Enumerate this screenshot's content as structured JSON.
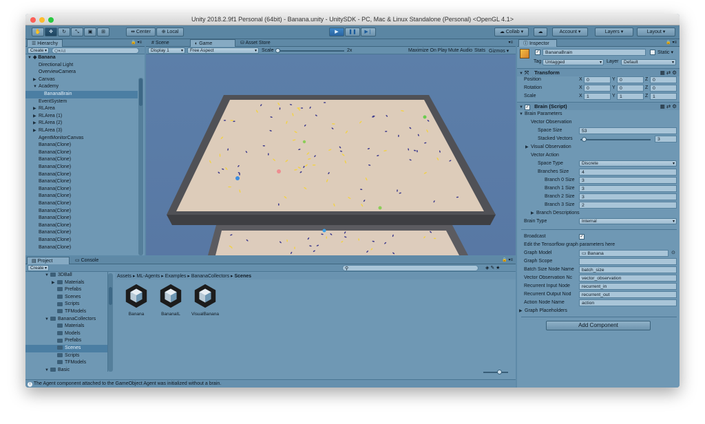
{
  "window": {
    "title": "Unity 2018.2.9f1 Personal (64bit) - Banana.unity - UnitySDK - PC, Mac & Linux Standalone (Personal) <OpenGL 4.1>"
  },
  "toolbar": {
    "pivot": "Center",
    "space": "Local",
    "collab": "Collab",
    "account": "Account",
    "layers": "Layers",
    "layout": "Layout"
  },
  "hierarchy": {
    "tab": "Hierarchy",
    "create": "Create",
    "search_placeholder": "Q▾All",
    "scene": "Banana",
    "items": [
      {
        "label": "Directional Light",
        "indent": 1,
        "arrow": ""
      },
      {
        "label": "OverviewCamera",
        "indent": 1,
        "arrow": ""
      },
      {
        "label": "Canvas",
        "indent": 1,
        "arrow": "▶"
      },
      {
        "label": "Academy",
        "indent": 1,
        "arrow": "▼"
      },
      {
        "label": "BananaBrain",
        "indent": 2,
        "arrow": "",
        "selected": true
      },
      {
        "label": "EventSystem",
        "indent": 1,
        "arrow": ""
      },
      {
        "label": "RLArea",
        "indent": 1,
        "arrow": "▶"
      },
      {
        "label": "RLArea (1)",
        "indent": 1,
        "arrow": "▶"
      },
      {
        "label": "RLArea (2)",
        "indent": 1,
        "arrow": "▶"
      },
      {
        "label": "RLArea (3)",
        "indent": 1,
        "arrow": "▶"
      },
      {
        "label": "AgentMonitorCanvas",
        "indent": 1,
        "arrow": ""
      },
      {
        "label": "Banana(Clone)",
        "indent": 1,
        "arrow": ""
      },
      {
        "label": "Banana(Clone)",
        "indent": 1,
        "arrow": ""
      },
      {
        "label": "Banana(Clone)",
        "indent": 1,
        "arrow": ""
      },
      {
        "label": "Banana(Clone)",
        "indent": 1,
        "arrow": ""
      },
      {
        "label": "Banana(Clone)",
        "indent": 1,
        "arrow": ""
      },
      {
        "label": "Banana(Clone)",
        "indent": 1,
        "arrow": ""
      },
      {
        "label": "Banana(Clone)",
        "indent": 1,
        "arrow": ""
      },
      {
        "label": "Banana(Clone)",
        "indent": 1,
        "arrow": ""
      },
      {
        "label": "Banana(Clone)",
        "indent": 1,
        "arrow": ""
      },
      {
        "label": "Banana(Clone)",
        "indent": 1,
        "arrow": ""
      },
      {
        "label": "Banana(Clone)",
        "indent": 1,
        "arrow": ""
      },
      {
        "label": "Banana(Clone)",
        "indent": 1,
        "arrow": ""
      },
      {
        "label": "Banana(Clone)",
        "indent": 1,
        "arrow": ""
      },
      {
        "label": "Banana(Clone)",
        "indent": 1,
        "arrow": ""
      },
      {
        "label": "Banana(Clone)",
        "indent": 1,
        "arrow": ""
      }
    ]
  },
  "game": {
    "tabs": [
      "Scene",
      "Game",
      "Asset Store"
    ],
    "display": "Display 1",
    "aspect": "Free Aspect",
    "scale_label": "Scale",
    "scale_value": "2x",
    "options": [
      "Maximize On Play",
      "Mute Audio",
      "Stats",
      "Gizmos"
    ]
  },
  "project": {
    "tabs": [
      "Project",
      "Console"
    ],
    "create": "Create",
    "tree": [
      {
        "label": "3DBall",
        "indent": 2,
        "arrow": "▼"
      },
      {
        "label": "Materials",
        "indent": 3,
        "arrow": "▶"
      },
      {
        "label": "Prefabs",
        "indent": 3,
        "arrow": ""
      },
      {
        "label": "Scenes",
        "indent": 3,
        "arrow": ""
      },
      {
        "label": "Scripts",
        "indent": 3,
        "arrow": ""
      },
      {
        "label": "TFModels",
        "indent": 3,
        "arrow": ""
      },
      {
        "label": "BananaCollectors",
        "indent": 2,
        "arrow": "▼"
      },
      {
        "label": "Materials",
        "indent": 3,
        "arrow": ""
      },
      {
        "label": "Models",
        "indent": 3,
        "arrow": ""
      },
      {
        "label": "Prefabs",
        "indent": 3,
        "arrow": ""
      },
      {
        "label": "Scenes",
        "indent": 3,
        "arrow": "",
        "selected": true
      },
      {
        "label": "Scripts",
        "indent": 3,
        "arrow": ""
      },
      {
        "label": "TFModels",
        "indent": 3,
        "arrow": ""
      },
      {
        "label": "Basic",
        "indent": 2,
        "arrow": "▼"
      }
    ],
    "breadcrumb": [
      "Assets",
      "ML-Agents",
      "Examples",
      "BananaCollectors",
      "Scenes"
    ],
    "assets": [
      "Banana",
      "BananaIL",
      "VisualBanana"
    ]
  },
  "status": {
    "message": "The Agent component attached to the GameObject Agent was initialized without a brain."
  },
  "inspector": {
    "tab": "Inspector",
    "object_name": "BananaBrain",
    "static_label": "Static",
    "tag_label": "Tag",
    "tag_value": "Untagged",
    "layer_label": "Layer",
    "layer_value": "Default",
    "transform": {
      "title": "Transform",
      "rows": [
        {
          "label": "Position",
          "x": "0",
          "y": "0",
          "z": "0"
        },
        {
          "label": "Rotation",
          "x": "0",
          "y": "0",
          "z": "0"
        },
        {
          "label": "Scale",
          "x": "1",
          "y": "1",
          "z": "1"
        }
      ]
    },
    "brain": {
      "title": "Brain (Script)",
      "brain_parameters": "Brain Parameters",
      "vector_observation": "Vector Observation",
      "space_size_label": "Space Size",
      "space_size": "53",
      "stacked_vectors_label": "Stacked Vectors",
      "stacked_vectors": "3",
      "stacked_slider_fraction": 0.03,
      "visual_observation": "Visual Observation",
      "vector_action": "Vector Action",
      "space_type_label": "Space Type",
      "space_type": "Discrete",
      "branches_size_label": "Branches Size",
      "branches_size": "4",
      "branches": [
        {
          "label": "Branch 0 Size",
          "value": "3"
        },
        {
          "label": "Branch 1 Size",
          "value": "3"
        },
        {
          "label": "Branch 2 Size",
          "value": "3"
        },
        {
          "label": "Branch 3 Size",
          "value": "2"
        }
      ],
      "branch_descriptions": "Branch Descriptions",
      "brain_type_label": "Brain Type",
      "brain_type": "Internal",
      "broadcast_label": "Broadcast",
      "tf_note": "Edit the Tensorflow graph parameters here",
      "graph_model_label": "Graph Model",
      "graph_model": "Banana",
      "graph_scope_label": "Graph Scope",
      "graph_scope": "",
      "nodes": [
        {
          "label": "Batch Size Node Name",
          "value": "batch_size"
        },
        {
          "label": "Vector Observation Nc",
          "value": "vector_observation"
        },
        {
          "label": "Recurrent Input Node",
          "value": "recurrent_in"
        },
        {
          "label": "Recurrent Output Nod",
          "value": "recurrent_out"
        },
        {
          "label": "Action Node Name",
          "value": "action"
        }
      ],
      "graph_placeholders": "Graph Placeholders"
    },
    "add_component": "Add Component"
  }
}
